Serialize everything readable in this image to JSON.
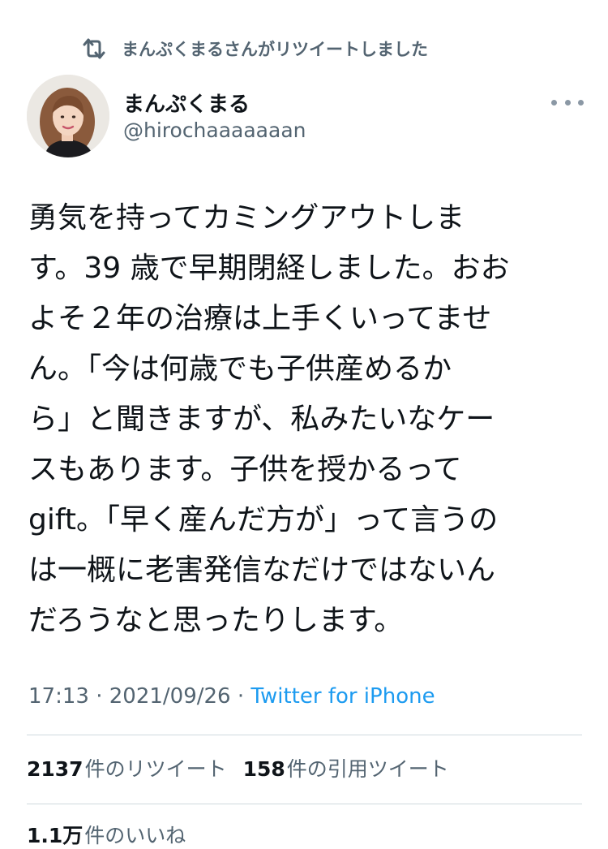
{
  "retweet": {
    "text": "まんぷくまるさんがリツイートしました",
    "icon": "retweet-icon"
  },
  "author": {
    "name": "まんぷくまる",
    "handle": "@hirochaaaaaaan",
    "avatar_icon": "profile-photo"
  },
  "tweet": {
    "lines": [
      "勇気を持ってカミングアウトしま",
      "す。39 歳で早期閉経しました。おお",
      "よそ２年の治療は上手くいってませ",
      "ん。「今は何歳でも子供産めるか",
      "ら」と聞きますが、私みたいなケー",
      "スもあります。子供を授かるって",
      "gift。「早く産んだ方が」って言うの",
      "は一概に老害発信なだけではないん",
      "だろうなと思ったりします。"
    ]
  },
  "meta": {
    "time": "17:13",
    "date": "2021/09/26",
    "separator": "·",
    "source": "Twitter for iPhone"
  },
  "stats": {
    "retweets": {
      "count": "2137",
      "label": "件のリツイート"
    },
    "quotes": {
      "count": "158",
      "label": "件の引用ツイート"
    },
    "likes": {
      "count": "1.1万",
      "label": "件のいいね"
    }
  },
  "colors": {
    "text": "#0f1419",
    "secondary": "#536471",
    "link": "#1d9bf0",
    "divider": "#cfd9de"
  }
}
